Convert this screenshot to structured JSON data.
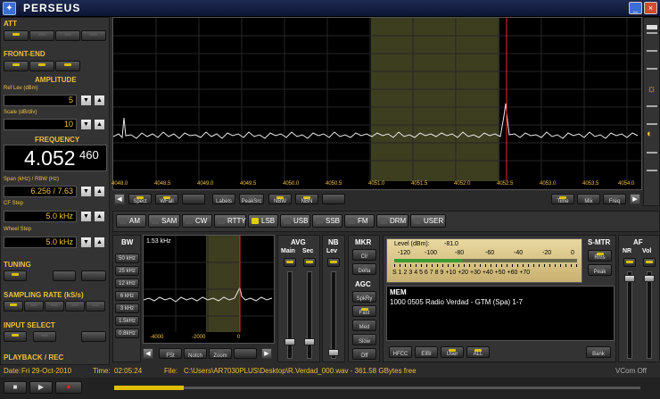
{
  "window": {
    "title": "PERSEUS",
    "min": "_",
    "close": "×"
  },
  "left": {
    "att": "ATT",
    "frontend": "FRONT-END",
    "amplitude": "AMPLITUDE",
    "ref_lev_label": "Ref Lev (dBm)",
    "ref_lev_value": "5",
    "scale_label": "Scale (dB/div)",
    "scale_value": "10",
    "frequency_label": "FREQUENCY",
    "freq_main": "4.052",
    "freq_sub": "460",
    "span_label": "Span (kHz) / RBW (Hz)",
    "span_value": "6.256 / 7.63",
    "cf_step_label": "CF Step",
    "cf_step_value": "5.0 kHz",
    "wheel_step_label": "Wheel Step",
    "wheel_step_value": "5.0 kHz",
    "tuning": "TUNING",
    "sampling": "SAMPLING RATE (kS/s)",
    "input": "INPUT SELECT",
    "playback": "PLAYBACK / REC"
  },
  "spectrum": {
    "freq_ticks": [
      "4048.0",
      "4048.5",
      "4049.0",
      "4049.5",
      "4050.0",
      "4050.5",
      "4051.0",
      "4051.5",
      "4052.0",
      "4052.5",
      "4053.0",
      "4053.5",
      "4054.0"
    ],
    "buttons": [
      "Spect",
      "WFall",
      "",
      "Labels",
      "PeakSrc",
      "NBW",
      "NBN",
      ""
    ],
    "right_buttons": [
      "Time",
      "Mix",
      "Freq"
    ]
  },
  "modes": [
    "AM",
    "SAM",
    "CW",
    "RTTY",
    "LSB",
    "USB",
    "SSB",
    "FM",
    "DRM",
    "USER"
  ],
  "bw": {
    "title": "BW",
    "value": "1.53 kHz",
    "items": [
      "50 kHz",
      "25 kHz",
      "12 kHz",
      "6 kHz",
      "3 kHz",
      "1.5kHz",
      "0.8kHz"
    ],
    "ticks": [
      "-4000",
      "-2000",
      "0"
    ],
    "buttons": [
      "FSt",
      "Notch",
      "Zoom"
    ]
  },
  "avg": {
    "title": "AVG",
    "main": "Main",
    "sec": "Sec"
  },
  "nb": {
    "title": "NB",
    "lev": "Lev"
  },
  "mkr": {
    "title": "MKR",
    "items": [
      "Clr",
      "Delta"
    ]
  },
  "agc": {
    "title": "AGC",
    "items": [
      "SpkRy",
      "Fast",
      "Med",
      "Slow",
      "Off"
    ]
  },
  "level": {
    "label": "Level (dBm):",
    "value": "-81.0",
    "top_scale": [
      "-120",
      "-100",
      "-80",
      "-60",
      "-40",
      "-20",
      "0"
    ],
    "bottom_scale": [
      "S",
      "1",
      "2",
      "3",
      "4",
      "5",
      "6",
      "7",
      "8",
      "9",
      "+10",
      "+20",
      "+30",
      "+40",
      "+50",
      "+60",
      "+70"
    ]
  },
  "smtr": {
    "title": "S-MTR",
    "items": [
      "Rms",
      "Peak"
    ]
  },
  "af": {
    "title": "AF",
    "nr": "NR",
    "vol": "Vol"
  },
  "mem": {
    "title": "MEM",
    "entry": "1000 0505 Radio Verdad  - GTM (Spa)  1-7",
    "buttons": [
      "HFCC",
      "EIBI",
      "User",
      "ALL"
    ],
    "bank": "Bank"
  },
  "status": {
    "date_label": "Date:",
    "date_value": "Fri 29-Oct-2010",
    "time_label": "Time:",
    "time_value": "02:05:24",
    "file_label": "File:",
    "file_value": "C:\\Users\\AR7030PLUS\\Desktop\\R.Verdad_000.wav - 361.58 GBytes free",
    "vcom": "VCom Off"
  }
}
